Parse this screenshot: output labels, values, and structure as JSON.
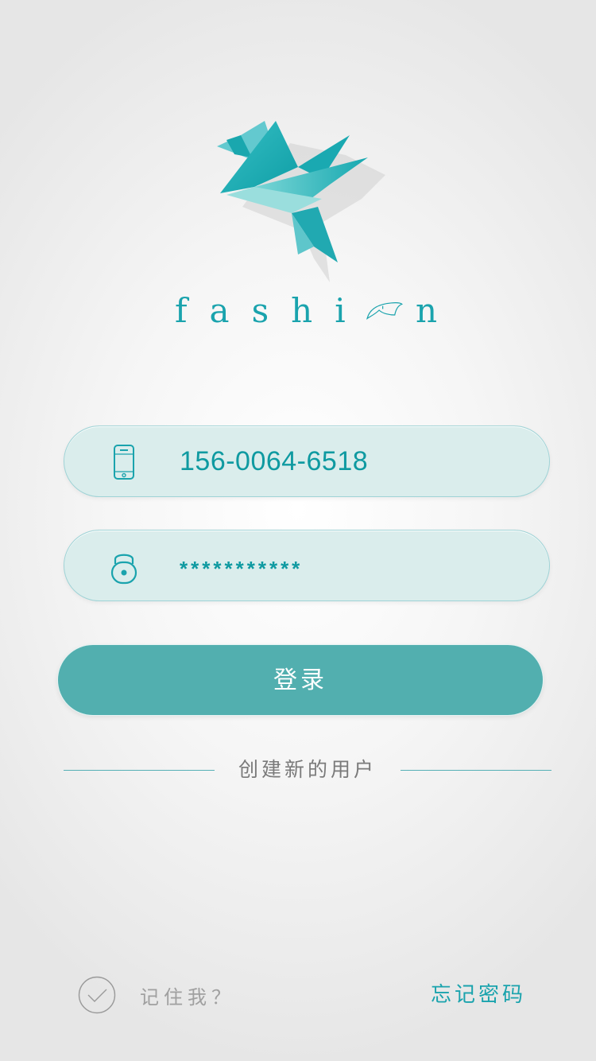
{
  "brand": {
    "logo_icon": "origami-bird-icon",
    "name_prefix": "fashi",
    "o_icon": "bird-head-icon",
    "name_suffix": "n",
    "accent_color": "#1aa3ad"
  },
  "form": {
    "phone": {
      "icon": "phone-icon",
      "value": "156-0064-6518"
    },
    "password": {
      "icon": "lock-icon",
      "value": "***********"
    },
    "login_label": "登录",
    "login_color": "#52afaf"
  },
  "create_user": {
    "label": "创建新的用户"
  },
  "footer": {
    "remember_icon": "check-circle-icon",
    "remember_label": "记住我？",
    "forgot_label": "忘记密码"
  }
}
